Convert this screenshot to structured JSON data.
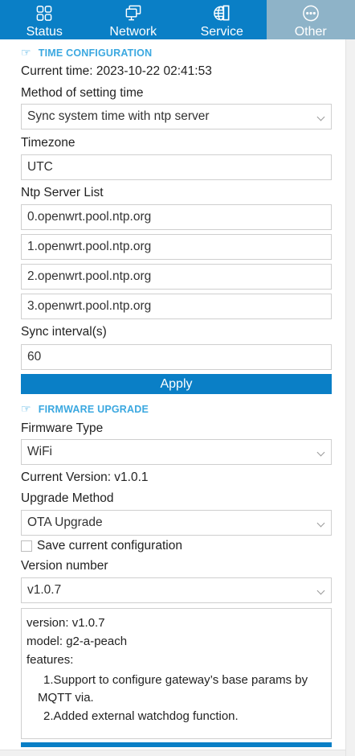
{
  "nav": {
    "tabs": [
      {
        "label": "Status",
        "icon": "grid-icon"
      },
      {
        "label": "Network",
        "icon": "monitor-icon"
      },
      {
        "label": "Service",
        "icon": "globe-icon"
      },
      {
        "label": "Other",
        "icon": "more-icon"
      }
    ],
    "active_index": 3,
    "colors": {
      "bar": "#0a7fc6",
      "active": "#8eb3c8"
    }
  },
  "time_config": {
    "title": "TIME CONFIGURATION",
    "current_time": "Current time: 2023-10-22 02:41:53",
    "method_label": "Method of setting time",
    "method_value": "Sync system time with ntp server",
    "timezone_label": "Timezone",
    "timezone_value": "UTC",
    "ntp_label": "Ntp Server List",
    "ntp_servers": [
      "0.openwrt.pool.ntp.org",
      "1.openwrt.pool.ntp.org",
      "2.openwrt.pool.ntp.org",
      "3.openwrt.pool.ntp.org"
    ],
    "sync_label": "Sync interval(s)",
    "sync_value": "60",
    "apply_label": "Apply"
  },
  "firmware": {
    "title": "FIRMWARE UPGRADE",
    "type_label": "Firmware Type",
    "type_value": "WiFi",
    "current_version": "Current Version: v1.0.1",
    "method_label": "Upgrade Method",
    "method_value": "OTA Upgrade",
    "save_config_label": "Save current configuration",
    "save_config_checked": false,
    "version_label": "Version number",
    "version_value": "v1.0.7",
    "notes": {
      "version": "version: v1.0.7",
      "model": "model: g2-a-peach",
      "features_label": "features:",
      "feature_1": "1.Support to configure gateway’s base params by MQTT via.",
      "feature_2": "2.Added external watchdog function."
    }
  },
  "accent_color": "#0a7fc6",
  "section_title_color": "#3ba8e0"
}
